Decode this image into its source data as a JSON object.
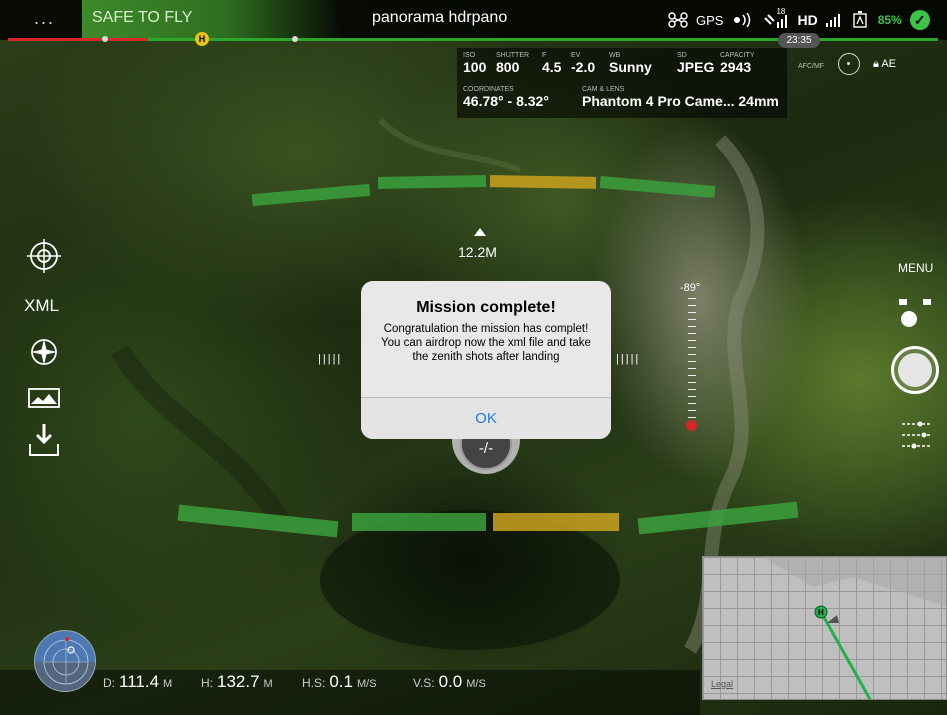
{
  "topbar": {
    "menu_dots": "...",
    "flight_status": "SAFE TO FLY",
    "mission_title": "panorama  hdrpano",
    "home_marker": "H",
    "gps_label": "GPS",
    "satellite_count": "18",
    "hd_label": "HD",
    "battery_percent": "85%",
    "time": "23:35"
  },
  "camera": {
    "iso_label": "ISO",
    "iso_value": "100",
    "shutter_label": "SHUTTER",
    "shutter_value": "800",
    "f_label": "F",
    "f_value": "4.5",
    "ev_label": "EV",
    "ev_value": "-2.0",
    "wb_label": "WB",
    "wb_value": "Sunny",
    "sd_label": "SD",
    "sd_value": "JPEG",
    "capacity_label": "Capacity",
    "capacity_value": "2943",
    "coordinates_label": "COORDINATES",
    "coordinates_value": "46.78° - 8.32°",
    "cam_lens_label": "CAM & LENS",
    "cam_lens_value": "Phantom 4 Pro Came... 24mm",
    "af_mf": "AFC/MF",
    "ae_lock": "AE"
  },
  "hud": {
    "altitude_marker": "12.2M",
    "gimbal_angle": "-89°",
    "speed_dial": "-/-",
    "ticks_left": "|||||",
    "ticks_right": "|||||"
  },
  "left_toolbar": {
    "xml_label": "XML"
  },
  "right_toolbar": {
    "menu_label": "MENU"
  },
  "dialog": {
    "title": "Mission complete!",
    "message": "Congratulation the mission has complet! You can airdrop now the xml file and take the zenith shots after landing",
    "ok_label": "OK"
  },
  "telemetry": {
    "d_label": "D:",
    "d_value": "111.4",
    "d_unit": "M",
    "h_label": "H:",
    "h_value": "132.7",
    "h_unit": "M",
    "hs_label": "H.S:",
    "hs_value": "0.1",
    "hs_unit": "M/S",
    "vs_label": "V.S:",
    "vs_value": "0.0",
    "vs_unit": "M/S"
  },
  "minimap": {
    "legal_label": "Legal",
    "home_marker": "H"
  },
  "colors": {
    "accent_green": "#3ba03c",
    "warning_yellow": "#caa21e",
    "alert_red": "#d6262a",
    "dialog_button_blue": "#1e7cf2"
  }
}
